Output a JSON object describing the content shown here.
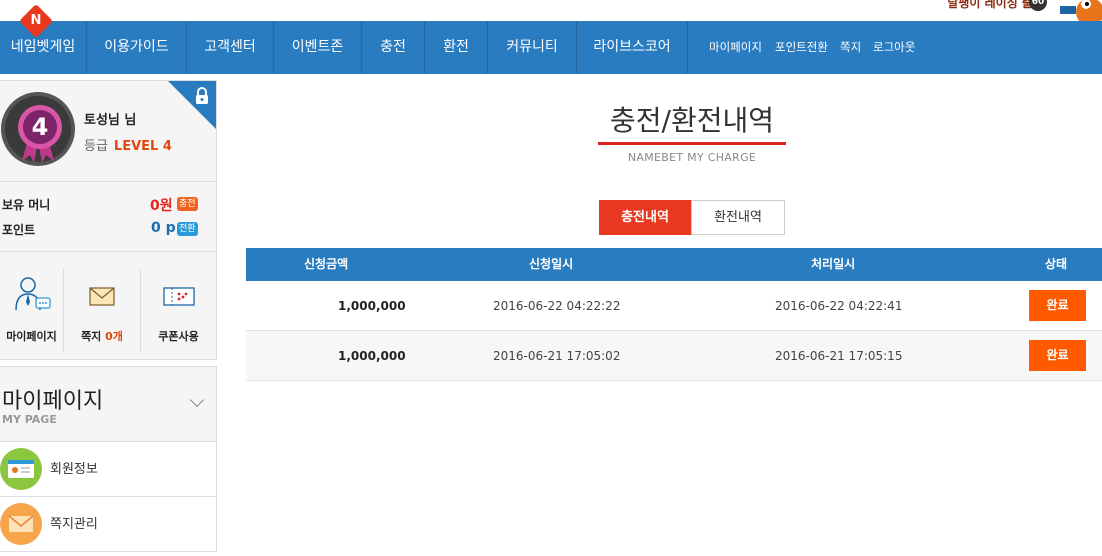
{
  "topbar": {
    "logo_letter": "N",
    "promo_text": "달팽이 레이싱 출시",
    "promo_badge": "60"
  },
  "nav": {
    "items": [
      "네임벳게임",
      "이용가이드",
      "고객센터",
      "이벤트존",
      "충전",
      "환전",
      "커뮤니티",
      "라이브스코어"
    ],
    "sub_items": [
      "마이페이지",
      "포인트전환",
      "쪽지",
      "로그아웃"
    ]
  },
  "profile": {
    "level_number": "4",
    "nickname": "토성님 님",
    "grade_label": "등급",
    "grade_value": "LEVEL 4",
    "money_label": "보유 머니",
    "money_value": "0원",
    "money_action": "충전",
    "point_label": "포인트",
    "point_value": "0 p",
    "point_action": "전환",
    "quick_links": [
      {
        "label": "마이페이지"
      },
      {
        "label_prefix": "쪽지 ",
        "count": "0개"
      },
      {
        "label": "쿠폰사용"
      }
    ]
  },
  "mypage": {
    "title": "마이페이지",
    "subtitle": "MY PAGE",
    "menu": [
      {
        "label": "회원정보"
      },
      {
        "label": "쪽지관리"
      }
    ]
  },
  "main": {
    "title": "충전/환전내역",
    "subtitle": "NAMEBET MY CHARGE",
    "tabs": [
      {
        "label": "충전내역",
        "active": true
      },
      {
        "label": "환전내역",
        "active": false
      }
    ],
    "table": {
      "headers": [
        "신청금액",
        "신청일시",
        "처리일시",
        "상태"
      ],
      "rows": [
        {
          "amount": "1,000,000",
          "requested": "2016-06-22 04:22:22",
          "processed": "2016-06-22 04:22:41",
          "status": "완료"
        },
        {
          "amount": "1,000,000",
          "requested": "2016-06-21 17:05:02",
          "processed": "2016-06-21 17:05:15",
          "status": "완료"
        }
      ]
    }
  },
  "colors": {
    "nav_blue": "#2a7cc0",
    "accent_red": "#e8381f",
    "status_orange": "#ff5a00"
  }
}
